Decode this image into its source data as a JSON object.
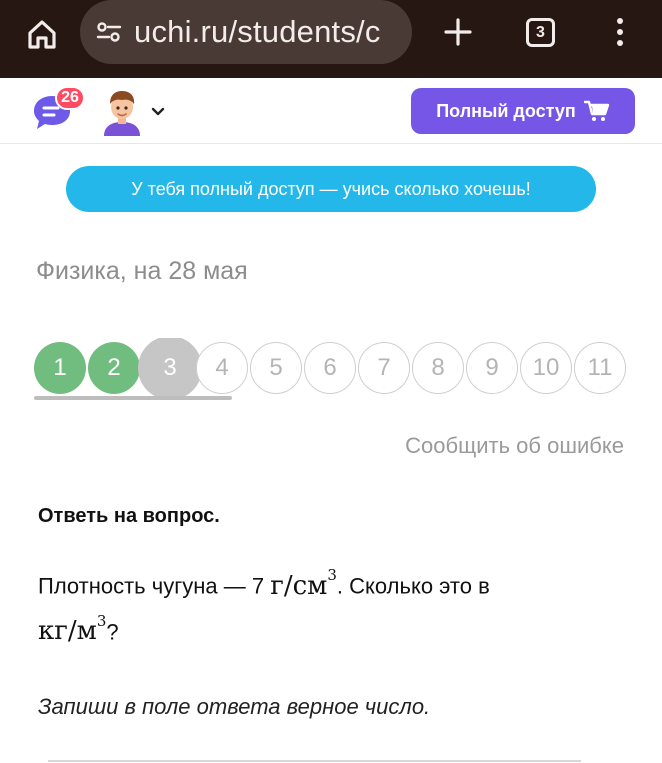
{
  "browser": {
    "url": "uchi.ru/students/c",
    "tab_count": "3"
  },
  "header": {
    "chat_badge": "26",
    "cta_label": "Полный доступ"
  },
  "banner": {
    "text": "У тебя полный доступ — учись сколько хочешь!"
  },
  "lesson": {
    "subject": "Физика, на 28 мая",
    "steps": [
      {
        "label": "1",
        "state": "done"
      },
      {
        "label": "2",
        "state": "done"
      },
      {
        "label": "3",
        "state": "current"
      },
      {
        "label": "4",
        "state": "todo"
      },
      {
        "label": "5",
        "state": "todo"
      },
      {
        "label": "6",
        "state": "todo"
      },
      {
        "label": "7",
        "state": "todo"
      },
      {
        "label": "8",
        "state": "todo"
      },
      {
        "label": "9",
        "state": "todo"
      },
      {
        "label": "10",
        "state": "todo"
      },
      {
        "label": "11",
        "state": "todo"
      }
    ],
    "report_label": "Сообщить об ошибке"
  },
  "question": {
    "title": "Ответь на вопрос.",
    "text_before": "Плотность чугуна — 7 ",
    "unit1": "г/см",
    "unit1_exp": "3",
    "text_middle": ". Сколько это в ",
    "unit2": "кг/м",
    "unit2_exp": "3",
    "text_after": "?",
    "hint": "Запиши в поле ответа верное число."
  },
  "colors": {
    "browser_bg": "#271712",
    "cta": "#7556e6",
    "banner": "#23b8e9",
    "done_step": "#71bd7f",
    "current_step": "#c6c6c6",
    "badge": "#ff4b63"
  }
}
